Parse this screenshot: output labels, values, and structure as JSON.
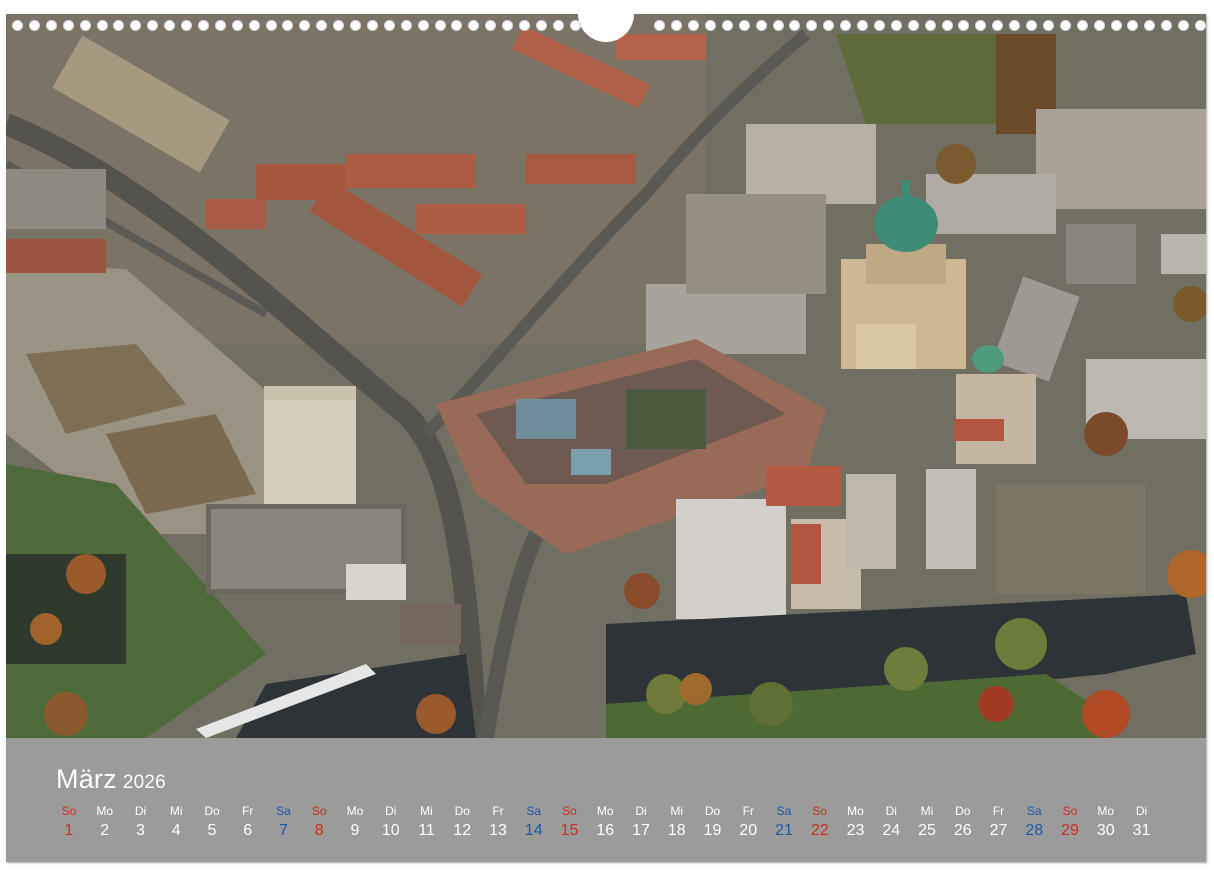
{
  "calendar": {
    "month": "März",
    "year": "2026",
    "colors": {
      "sunday": "#d12c1c",
      "saturday": "#1c57a8",
      "weekday": "#ffffff",
      "panel": "#9b9b9b"
    },
    "days": [
      {
        "wd": "So",
        "d": "1",
        "type": "sun"
      },
      {
        "wd": "Mo",
        "d": "2",
        "type": "day"
      },
      {
        "wd": "Di",
        "d": "3",
        "type": "day"
      },
      {
        "wd": "Mi",
        "d": "4",
        "type": "day"
      },
      {
        "wd": "Do",
        "d": "5",
        "type": "day"
      },
      {
        "wd": "Fr",
        "d": "6",
        "type": "day"
      },
      {
        "wd": "Sa",
        "d": "7",
        "type": "sat"
      },
      {
        "wd": "So",
        "d": "8",
        "type": "sun"
      },
      {
        "wd": "Mo",
        "d": "9",
        "type": "day"
      },
      {
        "wd": "Di",
        "d": "10",
        "type": "day"
      },
      {
        "wd": "Mi",
        "d": "11",
        "type": "day"
      },
      {
        "wd": "Do",
        "d": "12",
        "type": "day"
      },
      {
        "wd": "Fr",
        "d": "13",
        "type": "day"
      },
      {
        "wd": "Sa",
        "d": "14",
        "type": "sat"
      },
      {
        "wd": "So",
        "d": "15",
        "type": "sun"
      },
      {
        "wd": "Mo",
        "d": "16",
        "type": "day"
      },
      {
        "wd": "Di",
        "d": "17",
        "type": "day"
      },
      {
        "wd": "Mi",
        "d": "18",
        "type": "day"
      },
      {
        "wd": "Do",
        "d": "19",
        "type": "day"
      },
      {
        "wd": "Fr",
        "d": "20",
        "type": "day"
      },
      {
        "wd": "Sa",
        "d": "21",
        "type": "sat"
      },
      {
        "wd": "So",
        "d": "22",
        "type": "sun"
      },
      {
        "wd": "Mo",
        "d": "23",
        "type": "day"
      },
      {
        "wd": "Di",
        "d": "24",
        "type": "day"
      },
      {
        "wd": "Mi",
        "d": "25",
        "type": "day"
      },
      {
        "wd": "Do",
        "d": "26",
        "type": "day"
      },
      {
        "wd": "Fr",
        "d": "27",
        "type": "day"
      },
      {
        "wd": "Sa",
        "d": "28",
        "type": "sat"
      },
      {
        "wd": "So",
        "d": "29",
        "type": "sun"
      },
      {
        "wd": "Mo",
        "d": "30",
        "type": "day"
      },
      {
        "wd": "Di",
        "d": "31",
        "type": "day"
      }
    ]
  }
}
